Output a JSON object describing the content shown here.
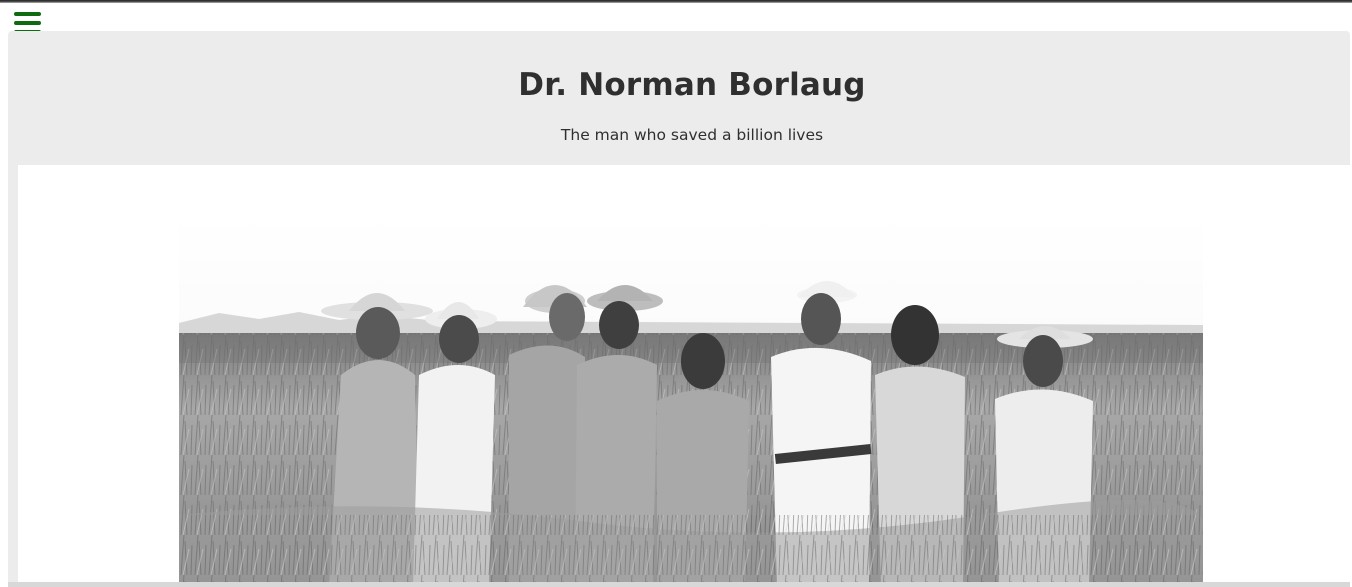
{
  "nav": {
    "menu_icon": "hamburger-icon",
    "menu_color": "#0f6b0f"
  },
  "header": {
    "title": "Dr. Norman Borlaug",
    "subtitle": "The man who saved a billion lives"
  },
  "main": {
    "photo": {
      "colors": {
        "sky": "#ffffff",
        "field": "#9a9a9a"
      }
    }
  }
}
